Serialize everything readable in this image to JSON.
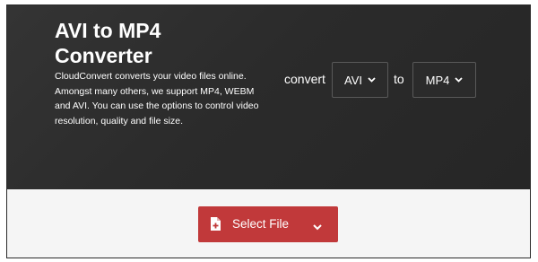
{
  "hero": {
    "title_line1": "AVI to MP4",
    "title_line2": "Converter",
    "description": "CloudConvert converts your video files online. Amongst many others, we support MP4, WEBM and AVI. You can use the options to control video resolution, quality and file size."
  },
  "converter": {
    "convert_label": "convert",
    "from_format": "AVI",
    "to_label": "to",
    "to_format": "MP4"
  },
  "upload": {
    "select_file_label": "Select File"
  },
  "icons": {
    "file": "file-plus-icon",
    "dropdown": "chevron-down-icon"
  },
  "colors": {
    "hero_background": "#2e2e2e",
    "button_red": "#c1393a",
    "lower_background": "#f5f5f5"
  }
}
